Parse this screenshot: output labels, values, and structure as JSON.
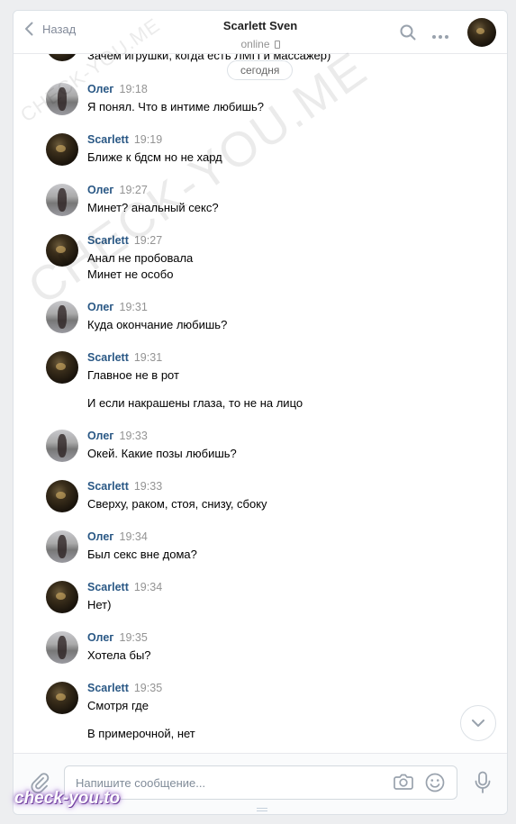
{
  "header": {
    "back_label": "Назад",
    "contact_name": "Scarlett Sven",
    "status": "online"
  },
  "feed": {
    "date_divider": "сегодня",
    "cut_message": "Зачем игрушки, когда есть ЛМП и массажер)",
    "messages": [
      {
        "author": "Олег",
        "time": "19:18",
        "lines": [
          "Я понял. Что в интиме любишь?"
        ]
      },
      {
        "author": "Scarlett",
        "time": "19:19",
        "lines": [
          "Ближе к бдсм но не хард"
        ]
      },
      {
        "author": "Олег",
        "time": "19:27",
        "lines": [
          "Минет? анальный секс?"
        ]
      },
      {
        "author": "Scarlett",
        "time": "19:27",
        "lines": [
          "Анал не пробовала",
          "Минет не особо"
        ]
      },
      {
        "author": "Олег",
        "time": "19:31",
        "lines": [
          "Куда окончание любишь?"
        ]
      },
      {
        "author": "Scarlett",
        "time": "19:31",
        "lines": [
          "Главное не в рот",
          "",
          "И если накрашены глаза, то не на лицо"
        ]
      },
      {
        "author": "Олег",
        "time": "19:33",
        "lines": [
          "Окей. Какие позы любишь?"
        ]
      },
      {
        "author": "Scarlett",
        "time": "19:33",
        "lines": [
          "Сверху, раком, стоя, снизу, сбоку"
        ]
      },
      {
        "author": "Олег",
        "time": "19:34",
        "lines": [
          "Был секс вне дома?"
        ]
      },
      {
        "author": "Scarlett",
        "time": "19:34",
        "lines": [
          "Нет)"
        ]
      },
      {
        "author": "Олег",
        "time": "19:35",
        "lines": [
          "Хотела бы?"
        ]
      },
      {
        "author": "Scarlett",
        "time": "19:35",
        "lines": [
          "Смотря где",
          "",
          "В примерочной, нет"
        ]
      }
    ]
  },
  "composer": {
    "placeholder": "Напишите сообщение..."
  },
  "watermarks": {
    "small": "CHECK-YOU.ME",
    "large": "CHECK-YOU.ME",
    "brand": "check-you.to"
  },
  "colors": {
    "author": "#2a5885",
    "time": "#939393",
    "background": "#edeef0"
  }
}
